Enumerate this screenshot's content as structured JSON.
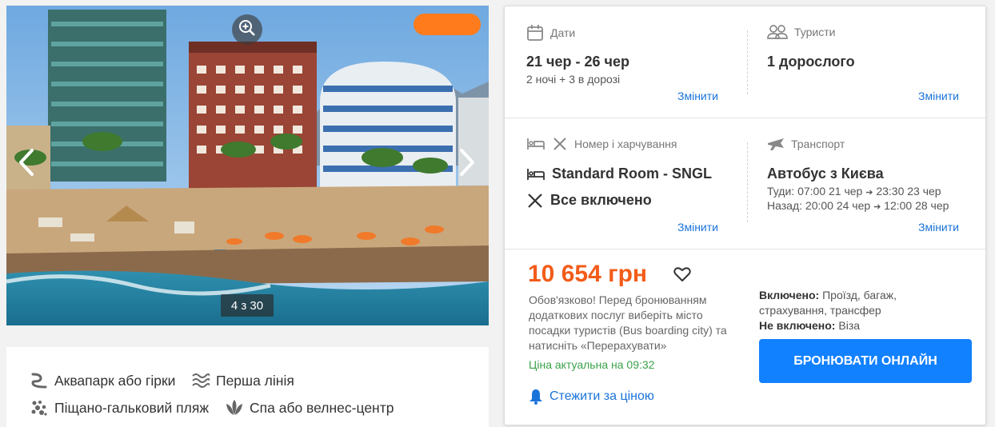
{
  "gallery": {
    "counter": "4 з 30",
    "zoom_icon": "zoom-in-icon",
    "prev_icon": "chevron-left-icon",
    "next_icon": "chevron-right-icon",
    "watermark_color": "#ff7b1c"
  },
  "features": [
    {
      "label": "Аквапарк або гірки",
      "icon": "waterslide-icon"
    },
    {
      "label": "Перша лінія",
      "icon": "waves-icon"
    },
    {
      "label": "Піщано-гальковий пляж",
      "icon": "pebbles-icon"
    },
    {
      "label": "Спа або велнес-центр",
      "icon": "lotus-icon"
    }
  ],
  "booking": {
    "dates": {
      "heading": "Дати",
      "range": "21 чер - 26 чер",
      "nights": "2 ночі + 3 в дорозі",
      "change": "Змінити"
    },
    "tourists": {
      "heading": "Туристи",
      "value": "1 дорослого",
      "change": "Змінити"
    },
    "room": {
      "heading": "Номер і харчування",
      "room_type": "Standard Room - SNGL",
      "meal": "Все включено",
      "change": "Змінити"
    },
    "transport": {
      "heading": "Транспорт",
      "value": "Автобус з Києва",
      "there_label": "Туди:",
      "there_dep": "07:00 21 чер",
      "there_arr": "23:30 23 чер",
      "back_label": "Назад:",
      "back_dep": "20:00 24 чер",
      "back_arr": "12:00 28 чер",
      "change": "Змінити"
    },
    "price": "10 654 грн",
    "notice": "Обов'язково! Перед бронюванням додаткових послуг виберіть місто посадки туристів (Bus boarding city) та натисніть «Перерахувати»",
    "actual": "Ціна актуальна на 09:32",
    "watch_price": "Стежити за ціною",
    "included_label": "Включено:",
    "included_value": "Проїзд, багаж, страхування, трансфер",
    "excluded_label": "Не включено:",
    "excluded_value": "Віза",
    "book_button": "БРОНЮВАТИ ОНЛАЙН"
  },
  "colors": {
    "accent": "#1281ff",
    "link": "#1a73d9",
    "price": "#f25c19",
    "actual": "#3aa14a"
  }
}
